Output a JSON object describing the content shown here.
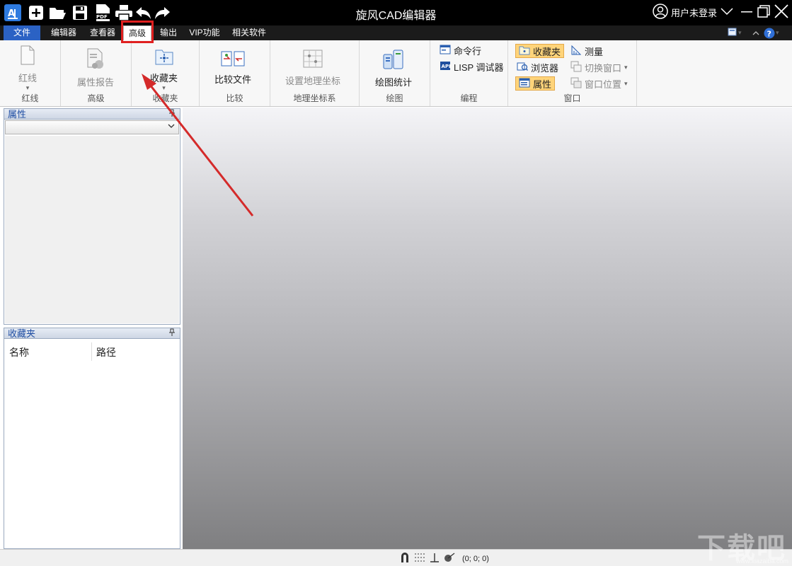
{
  "window": {
    "title": "旋风CAD编辑器",
    "user_label": "用户未登录"
  },
  "quick_access": [
    "app-logo-icon",
    "new-file-icon",
    "open-folder-icon",
    "save-icon",
    "pdf-icon",
    "print-icon",
    "undo-icon",
    "redo-icon"
  ],
  "menu_tabs": [
    {
      "label": "文件"
    },
    {
      "label": "编辑器"
    },
    {
      "label": "查看器"
    },
    {
      "label": "高级",
      "active": true
    },
    {
      "label": "输出"
    },
    {
      "label": "VIP功能"
    },
    {
      "label": "相关软件"
    }
  ],
  "ribbon": {
    "groups": {
      "redline": {
        "label": "红线",
        "button": "红线"
      },
      "advanced": {
        "label": "高级",
        "button": "属性报告"
      },
      "favorites": {
        "label": "收藏夹",
        "button": "收藏夹"
      },
      "compare": {
        "label": "比较",
        "button": "比较文件"
      },
      "geo": {
        "label": "地理坐标系",
        "button": "设置地理坐标"
      },
      "drawing": {
        "label": "绘图",
        "button": "绘图统计"
      },
      "programming": {
        "label": "编程",
        "items": [
          "命令行",
          "LISP 调试器"
        ]
      },
      "window": {
        "label": "窗口",
        "items": [
          "收藏夹",
          "测量",
          "浏览器",
          "切换窗口",
          "属性",
          "窗口位置"
        ]
      }
    }
  },
  "panels": {
    "properties": {
      "title": "属性"
    },
    "favorites": {
      "title": "收藏夹",
      "columns": [
        "名称",
        "路径"
      ]
    }
  },
  "statusbar": {
    "coords": "(0; 0; 0)"
  },
  "watermark": {
    "text": "下载吧",
    "url": "www.xiazaiba.com"
  },
  "colors": {
    "titlebar": "#000000",
    "file_tab": "#2b62c4",
    "highlight": "#e02020",
    "toggle_on": "#ffd47a"
  }
}
